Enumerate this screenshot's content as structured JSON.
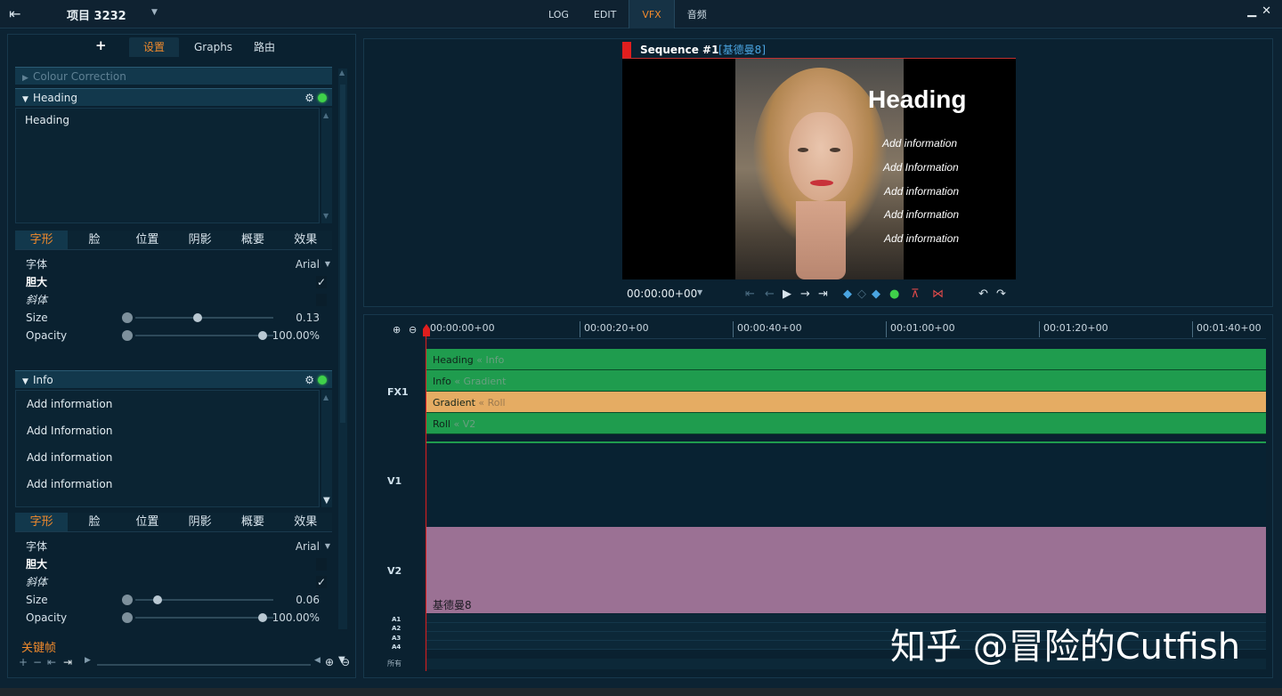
{
  "topbar": {
    "project_name": "项目 3232",
    "tabs": [
      "LOG",
      "EDIT",
      "VFX",
      "音频"
    ],
    "active_tab": "VFX"
  },
  "left_panel": {
    "add_label": "+",
    "tabs": [
      "设置",
      "Graphs",
      "路由"
    ],
    "active_tab": "设置",
    "sections": {
      "colour_correction": "Colour Correction",
      "heading": {
        "title": "Heading",
        "text": "Heading",
        "style_tabs": [
          "字形",
          "脸",
          "位置",
          "阴影",
          "概要",
          "效果"
        ],
        "font_label": "字体",
        "font_value": "Arial",
        "bold_label": "胆大",
        "bold_checked": true,
        "italic_label": "斜体",
        "italic_checked": false,
        "size_label": "Size",
        "size_value": "0.13",
        "opacity_label": "Opacity",
        "opacity_value": "100.00%"
      },
      "info": {
        "title": "Info",
        "lines": [
          "Add information",
          "Add Information",
          "Add information",
          "Add information"
        ],
        "style_tabs": [
          "字形",
          "脸",
          "位置",
          "阴影",
          "概要",
          "效果"
        ],
        "font_label": "字体",
        "font_value": "Arial",
        "bold_label": "胆大",
        "bold_checked": false,
        "italic_label": "斜体",
        "italic_checked": true,
        "size_label": "Size",
        "size_value": "0.06",
        "opacity_label": "Opacity",
        "opacity_value": "100.00%"
      }
    },
    "keyframes_label": "关键帧"
  },
  "preview": {
    "sequence_name": "Sequence #1",
    "clip_name": "[基德曼8]",
    "overlay_heading": "Heading",
    "overlay_lines": [
      "Add information",
      "Add Information",
      "Add information",
      "Add information",
      "Add information"
    ],
    "timecode": "00:00:00+00"
  },
  "timeline": {
    "ruler_ticks": [
      "00:00:00+00",
      "00:00:20+00",
      "00:00:40+00",
      "00:01:00+00",
      "00:01:20+00",
      "00:01:40+00"
    ],
    "tracks": {
      "fx1": "FX1",
      "v1": "V1",
      "v2": "V2",
      "audio": [
        "A1",
        "A2",
        "A3",
        "A4"
      ],
      "all": "所有"
    },
    "fx_clips": [
      {
        "name": "Heading",
        "sub": "« Info",
        "color": "#1f9c4e"
      },
      {
        "name": "Info",
        "sub": "« Gradient",
        "color": "#1f9c4e"
      },
      {
        "name": "Gradient",
        "sub": "« Roll",
        "color": "#e5ac63"
      },
      {
        "name": "Roll",
        "sub": "« V2",
        "color": "#1f9c4e"
      }
    ],
    "v2_clip_name": "基德曼8"
  },
  "watermark": "知乎 @冒险的Cutfish",
  "colors": {
    "accent": "#f08a2c",
    "playhead": "#e01e1e",
    "clip_green": "#1f9c4e",
    "clip_orange": "#e5ac63",
    "clip_purple": "#9b7194"
  }
}
